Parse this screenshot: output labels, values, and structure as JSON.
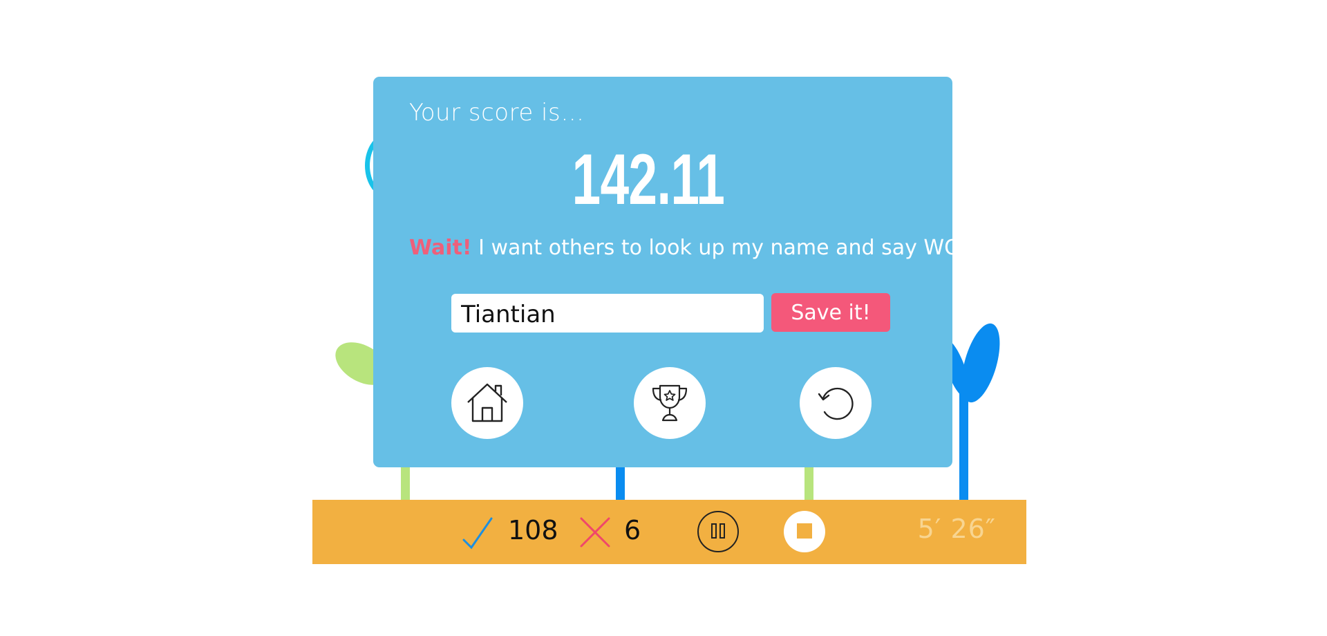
{
  "modal": {
    "prompt": "Your score is…",
    "score": "142.11",
    "message_highlight": "Wait!",
    "message_rest": " I want others to look up my name and say WOW…",
    "name_input_value": "Tiantian",
    "save_label": "Save it!"
  },
  "actions": [
    {
      "name": "home",
      "icon": "home-icon"
    },
    {
      "name": "leaderboard",
      "icon": "trophy-icon"
    },
    {
      "name": "replay",
      "icon": "replay-icon"
    }
  ],
  "status": {
    "correct_count": "108",
    "wrong_count": "6",
    "timer": "5′ 26″"
  },
  "colors": {
    "modal_bg": "#66bfe6",
    "accent_pink": "#f4587a",
    "status_bar": "#f2b041",
    "check_blue": "#1d8fe0",
    "cross_red": "#f0476a"
  }
}
